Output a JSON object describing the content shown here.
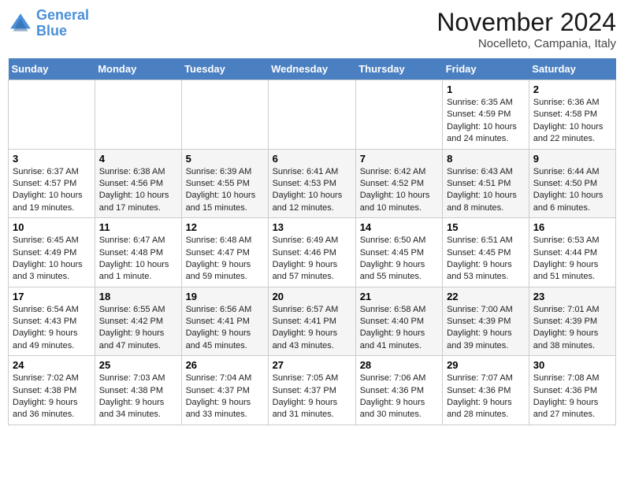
{
  "header": {
    "logo_line1": "General",
    "logo_line2": "Blue",
    "month_title": "November 2024",
    "location": "Nocelleto, Campania, Italy"
  },
  "weekdays": [
    "Sunday",
    "Monday",
    "Tuesday",
    "Wednesday",
    "Thursday",
    "Friday",
    "Saturday"
  ],
  "weeks": [
    [
      {
        "day": "",
        "info": ""
      },
      {
        "day": "",
        "info": ""
      },
      {
        "day": "",
        "info": ""
      },
      {
        "day": "",
        "info": ""
      },
      {
        "day": "",
        "info": ""
      },
      {
        "day": "1",
        "info": "Sunrise: 6:35 AM\nSunset: 4:59 PM\nDaylight: 10 hours and 24 minutes."
      },
      {
        "day": "2",
        "info": "Sunrise: 6:36 AM\nSunset: 4:58 PM\nDaylight: 10 hours and 22 minutes."
      }
    ],
    [
      {
        "day": "3",
        "info": "Sunrise: 6:37 AM\nSunset: 4:57 PM\nDaylight: 10 hours and 19 minutes."
      },
      {
        "day": "4",
        "info": "Sunrise: 6:38 AM\nSunset: 4:56 PM\nDaylight: 10 hours and 17 minutes."
      },
      {
        "day": "5",
        "info": "Sunrise: 6:39 AM\nSunset: 4:55 PM\nDaylight: 10 hours and 15 minutes."
      },
      {
        "day": "6",
        "info": "Sunrise: 6:41 AM\nSunset: 4:53 PM\nDaylight: 10 hours and 12 minutes."
      },
      {
        "day": "7",
        "info": "Sunrise: 6:42 AM\nSunset: 4:52 PM\nDaylight: 10 hours and 10 minutes."
      },
      {
        "day": "8",
        "info": "Sunrise: 6:43 AM\nSunset: 4:51 PM\nDaylight: 10 hours and 8 minutes."
      },
      {
        "day": "9",
        "info": "Sunrise: 6:44 AM\nSunset: 4:50 PM\nDaylight: 10 hours and 6 minutes."
      }
    ],
    [
      {
        "day": "10",
        "info": "Sunrise: 6:45 AM\nSunset: 4:49 PM\nDaylight: 10 hours and 3 minutes."
      },
      {
        "day": "11",
        "info": "Sunrise: 6:47 AM\nSunset: 4:48 PM\nDaylight: 10 hours and 1 minute."
      },
      {
        "day": "12",
        "info": "Sunrise: 6:48 AM\nSunset: 4:47 PM\nDaylight: 9 hours and 59 minutes."
      },
      {
        "day": "13",
        "info": "Sunrise: 6:49 AM\nSunset: 4:46 PM\nDaylight: 9 hours and 57 minutes."
      },
      {
        "day": "14",
        "info": "Sunrise: 6:50 AM\nSunset: 4:45 PM\nDaylight: 9 hours and 55 minutes."
      },
      {
        "day": "15",
        "info": "Sunrise: 6:51 AM\nSunset: 4:45 PM\nDaylight: 9 hours and 53 minutes."
      },
      {
        "day": "16",
        "info": "Sunrise: 6:53 AM\nSunset: 4:44 PM\nDaylight: 9 hours and 51 minutes."
      }
    ],
    [
      {
        "day": "17",
        "info": "Sunrise: 6:54 AM\nSunset: 4:43 PM\nDaylight: 9 hours and 49 minutes."
      },
      {
        "day": "18",
        "info": "Sunrise: 6:55 AM\nSunset: 4:42 PM\nDaylight: 9 hours and 47 minutes."
      },
      {
        "day": "19",
        "info": "Sunrise: 6:56 AM\nSunset: 4:41 PM\nDaylight: 9 hours and 45 minutes."
      },
      {
        "day": "20",
        "info": "Sunrise: 6:57 AM\nSunset: 4:41 PM\nDaylight: 9 hours and 43 minutes."
      },
      {
        "day": "21",
        "info": "Sunrise: 6:58 AM\nSunset: 4:40 PM\nDaylight: 9 hours and 41 minutes."
      },
      {
        "day": "22",
        "info": "Sunrise: 7:00 AM\nSunset: 4:39 PM\nDaylight: 9 hours and 39 minutes."
      },
      {
        "day": "23",
        "info": "Sunrise: 7:01 AM\nSunset: 4:39 PM\nDaylight: 9 hours and 38 minutes."
      }
    ],
    [
      {
        "day": "24",
        "info": "Sunrise: 7:02 AM\nSunset: 4:38 PM\nDaylight: 9 hours and 36 minutes."
      },
      {
        "day": "25",
        "info": "Sunrise: 7:03 AM\nSunset: 4:38 PM\nDaylight: 9 hours and 34 minutes."
      },
      {
        "day": "26",
        "info": "Sunrise: 7:04 AM\nSunset: 4:37 PM\nDaylight: 9 hours and 33 minutes."
      },
      {
        "day": "27",
        "info": "Sunrise: 7:05 AM\nSunset: 4:37 PM\nDaylight: 9 hours and 31 minutes."
      },
      {
        "day": "28",
        "info": "Sunrise: 7:06 AM\nSunset: 4:36 PM\nDaylight: 9 hours and 30 minutes."
      },
      {
        "day": "29",
        "info": "Sunrise: 7:07 AM\nSunset: 4:36 PM\nDaylight: 9 hours and 28 minutes."
      },
      {
        "day": "30",
        "info": "Sunrise: 7:08 AM\nSunset: 4:36 PM\nDaylight: 9 hours and 27 minutes."
      }
    ]
  ]
}
